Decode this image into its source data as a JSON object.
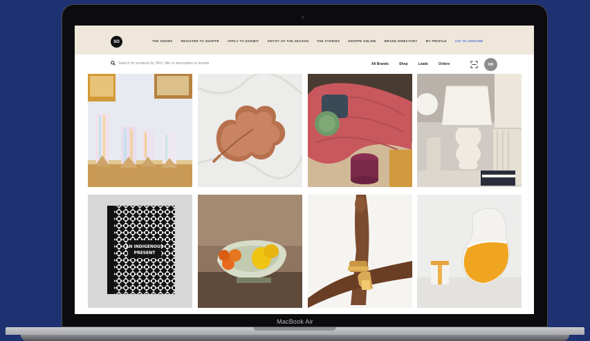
{
  "device": {
    "model_label": "MacBook Air"
  },
  "logo": {
    "text": "SO"
  },
  "nav": {
    "items": [
      {
        "label": "THE SHOWS"
      },
      {
        "label": "REGISTER TO SHOPPE"
      },
      {
        "label": "APPLY TO EXHIBIT"
      },
      {
        "label": "ARTIST OF THE SEASON"
      },
      {
        "label": "THE STORIES"
      },
      {
        "label": "SHOPPE ONLINE"
      },
      {
        "label": "BRAND DIRECTORY"
      },
      {
        "label": "MY PROFILE"
      },
      {
        "label": "AID TO UKRAINE"
      }
    ],
    "accent_color": "#4a6ad8"
  },
  "search": {
    "placeholder": "Search for products by SKU, title or description or brands",
    "value": ""
  },
  "toolbar": {
    "links": [
      {
        "label": "All Brands"
      },
      {
        "label": "Shop"
      },
      {
        "label": "Leads"
      },
      {
        "label": "Orders"
      }
    ],
    "scan_icon": "scan-icon"
  },
  "user": {
    "initials": "HR"
  },
  "products": [
    {
      "subject": "iridescent glass vases"
    },
    {
      "subject": "leaf-shaped wooden dish"
    },
    {
      "subject": "pink modular sofa with cushions"
    },
    {
      "subject": "ribbed ceramic table lamps"
    },
    {
      "subject": "patterned book",
      "cover_text": [
        "AN INDIGENOUS",
        "PRESENT"
      ]
    },
    {
      "subject": "ceramic bowl with citrus"
    },
    {
      "subject": "arms with gold cuffs"
    },
    {
      "subject": "orange and white ceramic pitcher"
    }
  ],
  "colors": {
    "background": "#1e3171",
    "nav_background": "#efe7da"
  }
}
